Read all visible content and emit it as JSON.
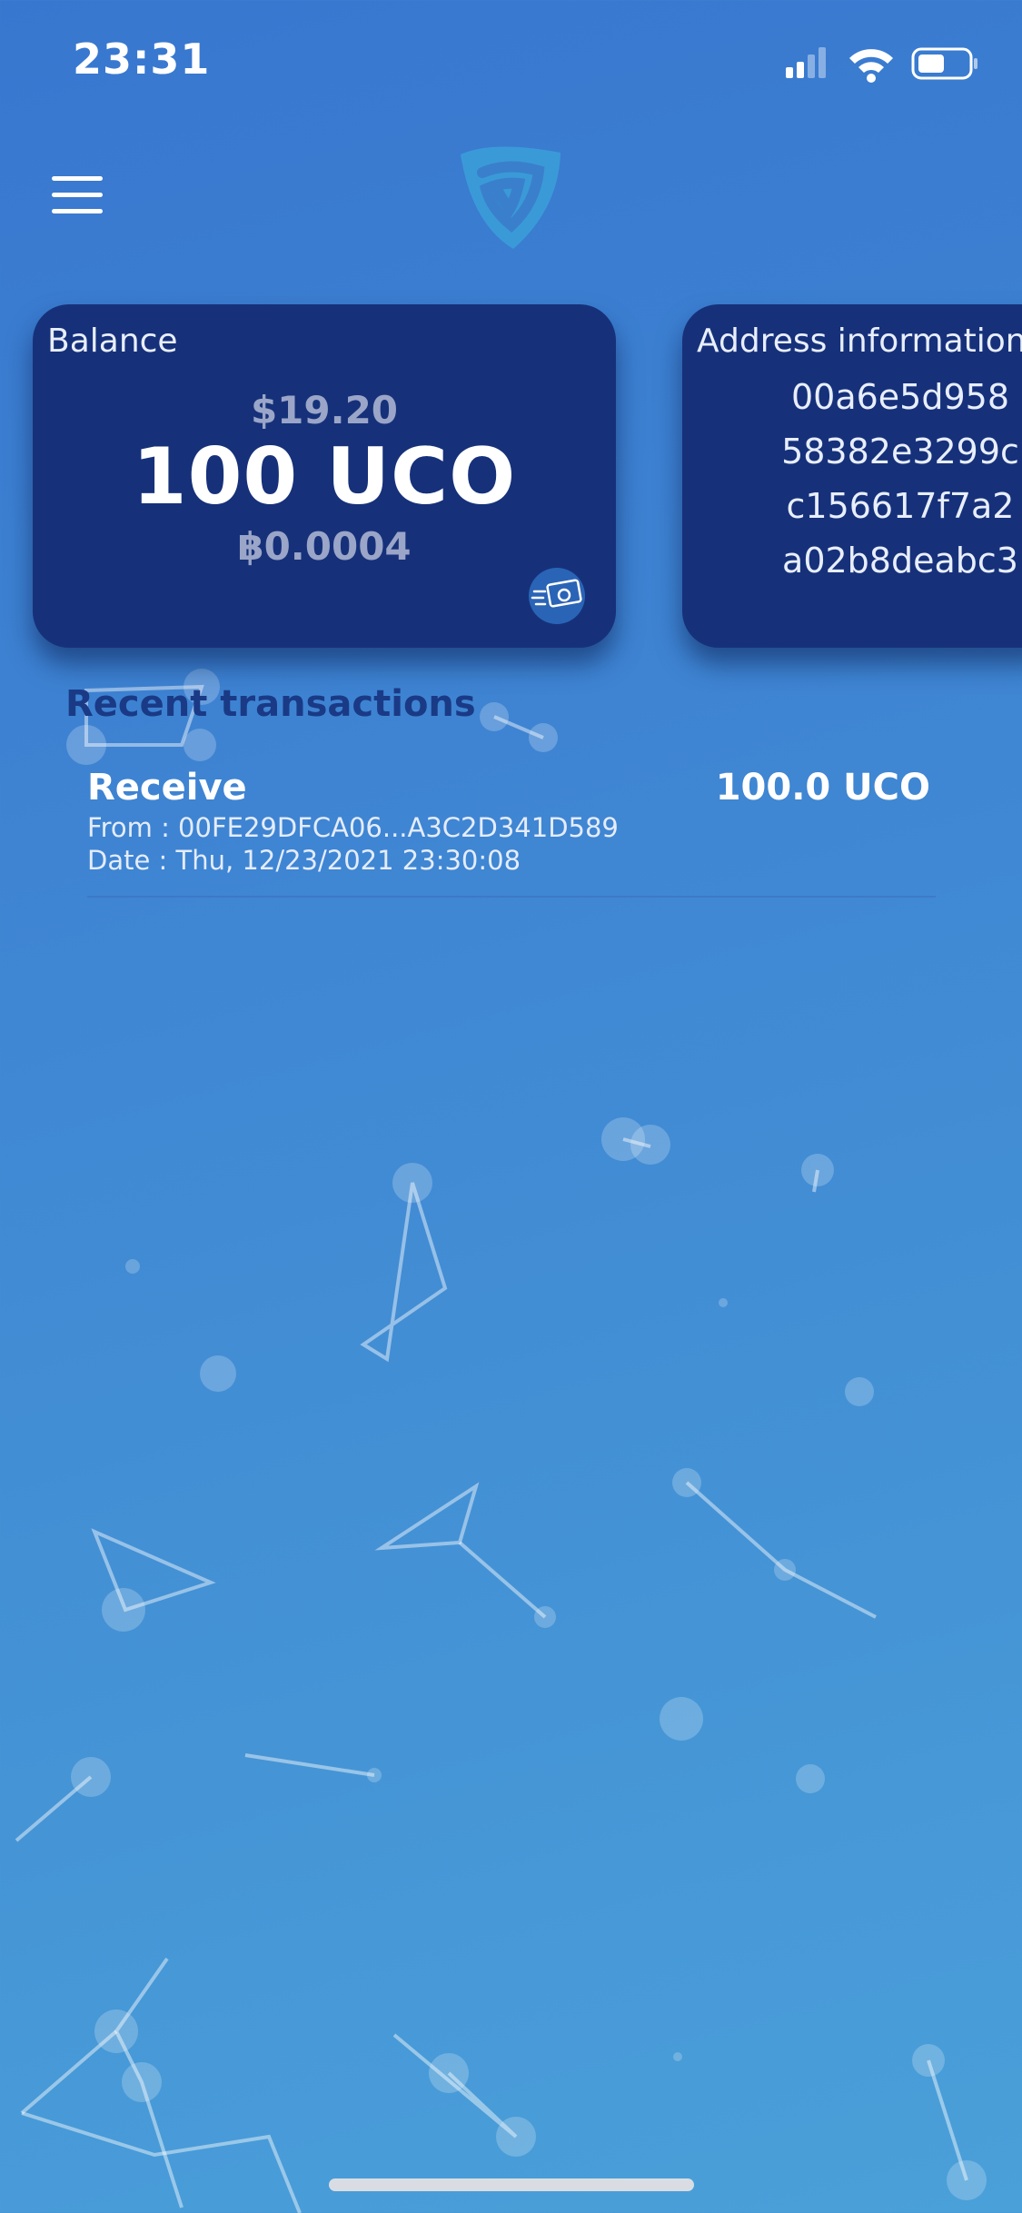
{
  "status_bar": {
    "time": "23:31"
  },
  "header": {
    "menu_icon": "hamburger-menu-icon",
    "logo": "shield-logo"
  },
  "balance_card": {
    "title": "Balance",
    "fiat_value": "$19.20",
    "uco_value": "100 UCO",
    "btc_value": "฿0.0004",
    "action_icon": "wallet-transfer-icon"
  },
  "address_card": {
    "title": "Address information",
    "lines": [
      "00a6e5d958",
      "58382e3299c",
      "c156617f7a2",
      "a02b8deabc3"
    ]
  },
  "transactions": {
    "title": "Recent transactions",
    "items": [
      {
        "type": "Receive",
        "amount": "100.0 UCO",
        "from": "From : 00FE29DFCA06...A3C2D341D589",
        "date": "Date : Thu, 12/23/2021 23:30:08"
      }
    ]
  },
  "colors": {
    "card_bg": "#16317a",
    "section_title": "#1a3a86",
    "bg_top": "#3877cf",
    "bg_bottom": "#4aa0d9"
  }
}
